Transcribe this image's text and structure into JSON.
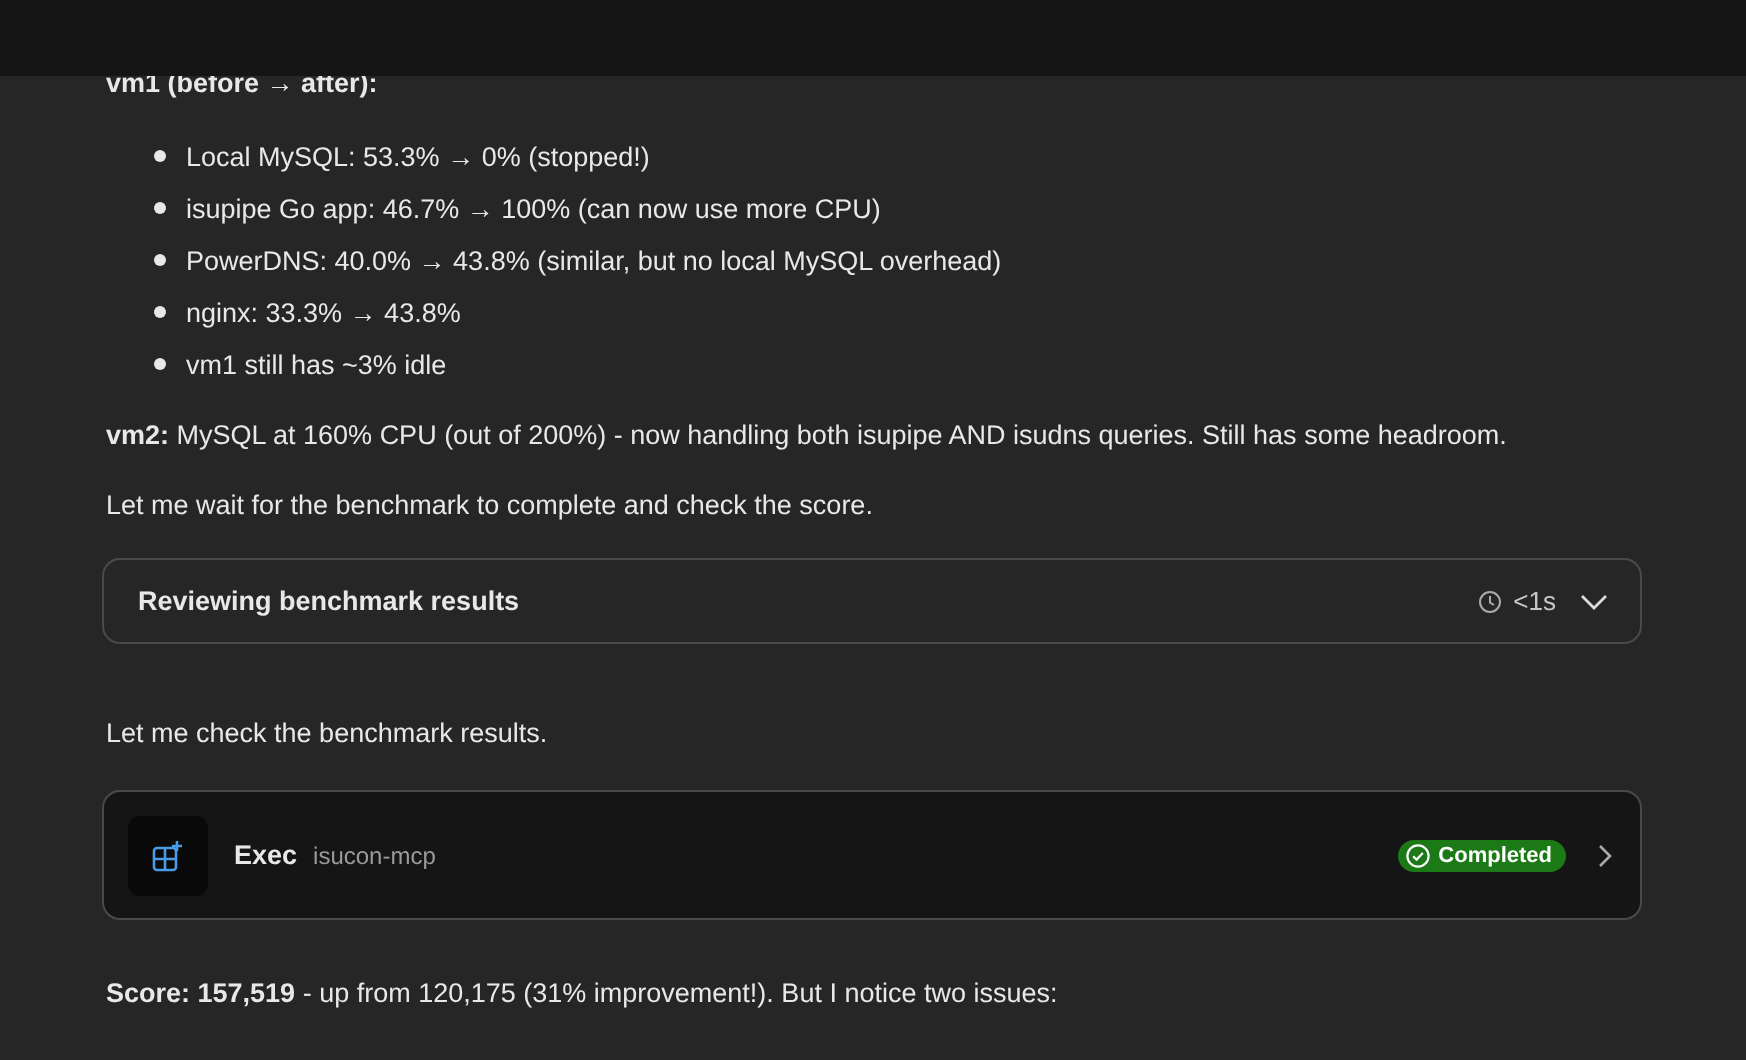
{
  "heading": "vm1 (before → after):",
  "bullets": [
    "Local MySQL: 53.3% → 0% (stopped!)",
    "isupipe Go app: 46.7% → 100% (can now use more CPU)",
    "PowerDNS: 40.0% → 43.8% (similar, but no local MySQL overhead)",
    "nginx: 33.3% → 43.8%",
    "vm1 still has ~3% idle"
  ],
  "paragraphs": [
    "**vm2:** MySQL at 160% CPU (out of 200%) - now handling both isupipe AND isudns queries. Still has some headroom.",
    "Let me wait for the benchmark to complete and check the score."
  ],
  "review": {
    "title": "Reviewing benchmark results",
    "duration": "<1s",
    "expanded": false
  },
  "paragraph_2": "Let me check the benchmark results.",
  "tool": {
    "name": "Exec",
    "server": "isucon-mcp",
    "status": "Completed"
  },
  "summary": "**Score: 157,519** - up from 120,175 (31% improvement!). But I notice two issues:"
}
